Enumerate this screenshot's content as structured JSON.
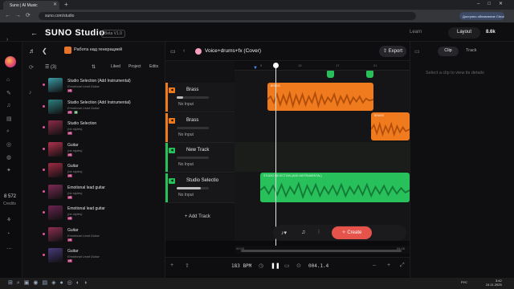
{
  "browser": {
    "tab_title": "Suno | AI Music",
    "url": "suno.com/studio",
    "update_label": "Доступно обновление Chrome"
  },
  "app": {
    "logo": "SUNO Studio",
    "beta": "Beta V1.0",
    "learn": "Learn",
    "layout": "Layout",
    "credits_top": "8.6k",
    "credits_num": "8 572",
    "credits_label": "Credits"
  },
  "library": {
    "workspace": "Работа над генерацией",
    "filter": "(3)",
    "sort": "⇅",
    "tabs": [
      "Liked",
      "Project",
      "Edits"
    ],
    "items": [
      {
        "title": "Studio Selection (Add Instrumental)",
        "sub": "Emotional Lead Guitar",
        "thumb": "#3b9aa6",
        "badge2": false
      },
      {
        "title": "Studio Selection (Add Instrumental)",
        "sub": "Emotional Lead Guitar",
        "thumb": "#2e7f7f",
        "badge2": true
      },
      {
        "title": "Studio Selection",
        "sub": "(no styles)",
        "thumb": "#8a2b48",
        "badge2": false
      },
      {
        "title": "Guitar",
        "sub": "(no styles)",
        "thumb": "#b0314d",
        "badge2": false
      },
      {
        "title": "Guitar",
        "sub": "(no styles)",
        "thumb": "#9f2a44",
        "badge2": false
      },
      {
        "title": "Emotional lead guitar",
        "sub": "(no styles)",
        "thumb": "#7c2a55",
        "badge2": false
      },
      {
        "title": "Emotional lead guitar",
        "sub": "(no styles)",
        "thumb": "#6b2450",
        "badge2": false
      },
      {
        "title": "Guitar",
        "sub": "Emotional Lead Guitar",
        "thumb": "#8e2e52",
        "badge2": false
      },
      {
        "title": "Guitar",
        "sub": "Emotional Lead Guitar",
        "thumb": "#4a3a7a",
        "badge2": false
      }
    ]
  },
  "arrangement": {
    "song_title": "Voice+drums+fx (Cover)",
    "export": "Export",
    "ruler": [
      "9",
      "13",
      "17",
      "21"
    ],
    "tracks": [
      {
        "name": "Brass",
        "input": "No Input",
        "color": "#f07b1e",
        "vol": 0.2
      },
      {
        "name": "Brass",
        "input": "No Input",
        "color": "#f07b1e",
        "vol": 0.0
      },
      {
        "name": "New Track",
        "input": "No Input",
        "color": "#27c05b",
        "vol": 0.0
      },
      {
        "name": "Studio Selectio",
        "input": "No Input",
        "color": "#27c05b",
        "vol": 0.75
      }
    ],
    "clips": [
      {
        "label": "BRASS"
      },
      {
        "label": "BRASS"
      },
      {
        "label": "STUDIO SELECTION (ADD INSTRUMENTAL)"
      }
    ],
    "add_track": "+ Add Track",
    "bpm": "183 BPM",
    "time": "004.1.4",
    "scroll_start": "00:00",
    "scroll_end": "04:45",
    "create": "Create"
  },
  "right_panel": {
    "clip_tab": "Clip",
    "track_tab": "Track",
    "hint": "Select a clip to view its details"
  },
  "taskbar": {
    "lang": "РУС",
    "time": "3:42",
    "date": "24.11.2025"
  }
}
